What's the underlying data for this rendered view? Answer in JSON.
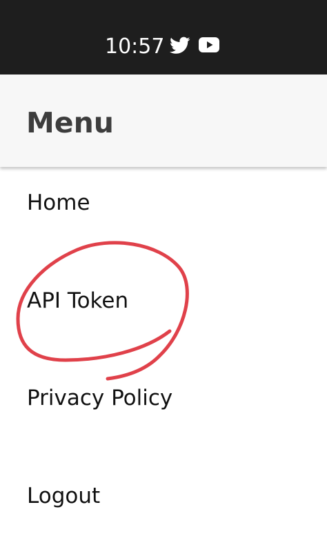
{
  "status_bar": {
    "time": "10:57",
    "icons": [
      "twitter-icon",
      "youtube-icon"
    ],
    "background": "#1e1e1e"
  },
  "header": {
    "title": "Menu",
    "background": "#f7f7f7"
  },
  "menu": {
    "items": [
      {
        "label": "Home"
      },
      {
        "label": "API Token"
      },
      {
        "label": "Privacy Policy"
      },
      {
        "label": "Logout"
      }
    ]
  },
  "annotation": {
    "type": "hand-drawn circle",
    "target": "API Token",
    "color": "#e0414a"
  }
}
